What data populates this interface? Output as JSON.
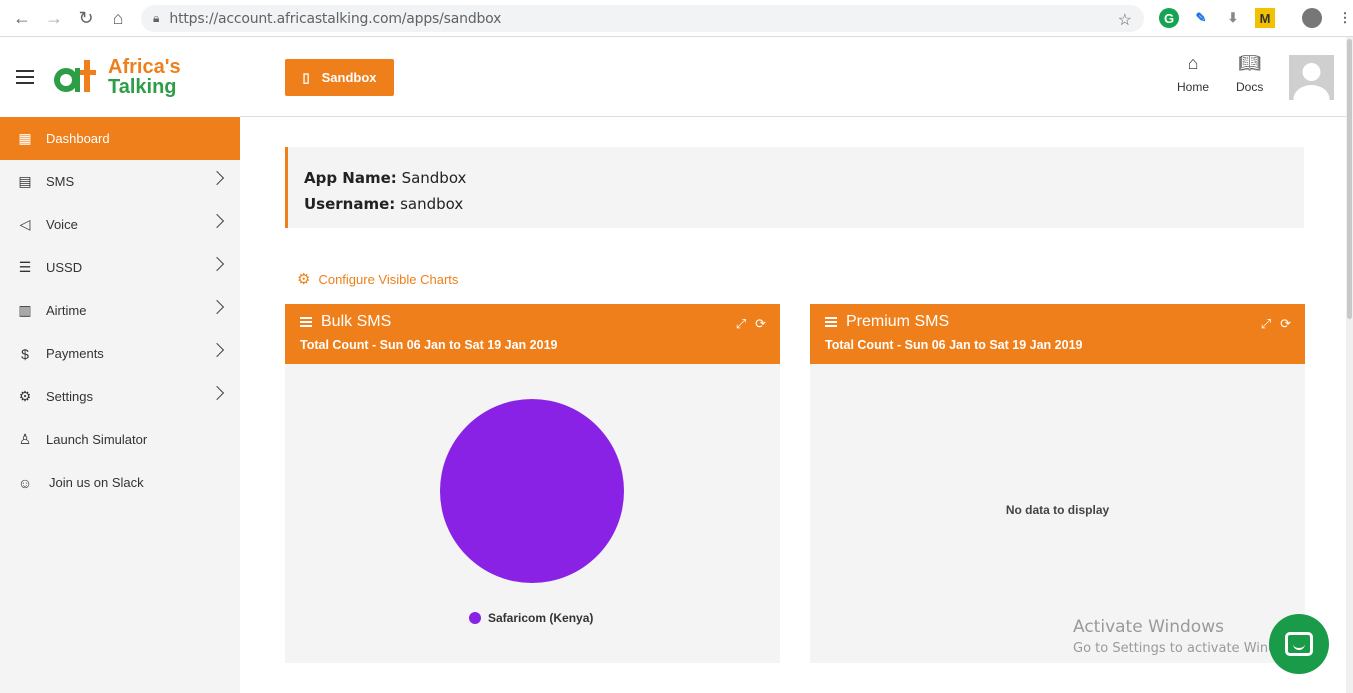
{
  "browser": {
    "url": "https://account.africastalking.com/apps/sandbox"
  },
  "brand": {
    "logo_line1": "Africa's",
    "logo_line2": "Talking",
    "accent": "#ef7f1a",
    "green": "#2e9e46"
  },
  "sidebar": {
    "items": [
      {
        "label": "Dashboard",
        "icon": "dashboard-icon",
        "active": true,
        "chevron": false
      },
      {
        "label": "SMS",
        "icon": "message-icon",
        "active": false,
        "chevron": true
      },
      {
        "label": "Voice",
        "icon": "megaphone-icon",
        "active": false,
        "chevron": true
      },
      {
        "label": "USSD",
        "icon": "list-icon",
        "active": false,
        "chevron": true
      },
      {
        "label": "Airtime",
        "icon": "receipt-icon",
        "active": false,
        "chevron": true
      },
      {
        "label": "Payments",
        "icon": "dollar-icon",
        "active": false,
        "chevron": true
      },
      {
        "label": "Settings",
        "icon": "gear-icon",
        "active": false,
        "chevron": true
      },
      {
        "label": "Launch Simulator",
        "icon": "rocket-icon",
        "active": false,
        "chevron": false
      },
      {
        "label": "Join us on Slack",
        "icon": "chat-icon",
        "active": false,
        "chevron": false
      }
    ]
  },
  "topbar": {
    "sandbox_label": "Sandbox",
    "home_label": "Home",
    "docs_label": "Docs"
  },
  "info": {
    "app_name_label": "App Name:",
    "app_name_value": " Sandbox",
    "username_label": "Username:",
    "username_value": " sandbox"
  },
  "config_link": "Configure Visible Charts",
  "cards": {
    "bulk": {
      "title": "Bulk SMS",
      "subtitle": "Total Count - Sun 06 Jan to Sat 19 Jan 2019",
      "legend": "Safaricom (Kenya)"
    },
    "premium": {
      "title": "Premium SMS",
      "subtitle": "Total Count - Sun 06 Jan to Sat 19 Jan 2019",
      "empty_text": "No data to display"
    }
  },
  "watermark": {
    "line1": "Activate Windows",
    "line2": "Go to Settings to activate Windows."
  }
}
